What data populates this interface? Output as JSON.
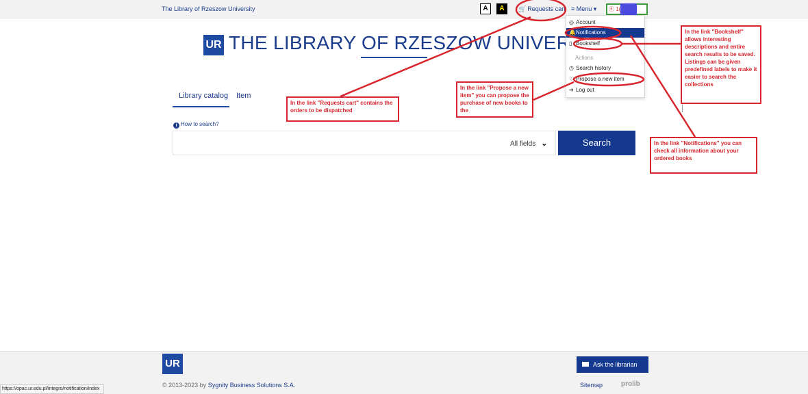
{
  "header": {
    "site_link": "The Library of Rzeszow University",
    "contrast_normal": "A",
    "contrast_high": "A",
    "cart_label": "Requests cart",
    "menu_label": "≡ Menu ▾",
    "user_label": "Ⓔ 1("
  },
  "logo": {
    "mark": "UR",
    "title": "THE LIBRARY OF RZESZOW UNIVERS"
  },
  "tabs": [
    {
      "label": "Library catalog",
      "active": true
    },
    {
      "label": "Item",
      "active": false
    }
  ],
  "search": {
    "help_link": "How to search?",
    "placeholder": "",
    "field_selected": "All fields",
    "button_label": "Search"
  },
  "menu": {
    "items": [
      {
        "label": "Account",
        "icon": "user-circle-icon"
      },
      {
        "label": "Notifications",
        "icon": "bell-icon",
        "active": true
      },
      {
        "label": "Bookshelf",
        "icon": "bookmark-icon"
      }
    ],
    "actions_heading": "Actions",
    "actions": [
      {
        "label": "Search history",
        "icon": "clock-icon"
      },
      {
        "label": "Propose a new item",
        "icon": "lightbulb-icon"
      },
      {
        "label": "Log out",
        "icon": "logout-icon"
      }
    ]
  },
  "annotations": {
    "cart": "In the link \"Requests cart\" contains the orders to be dispatched",
    "propose": "In the link \"Propose a new item\" you can propose the purchase of new books to the",
    "bookshelf": "In the link \"Bookshelf\" allows interesting descriptions and entire search results to be saved. Listings can be given predefined labels to make it easier to search the collections",
    "notifications": "In the link \"Notifications\" you can check all information about your ordered books"
  },
  "footer": {
    "logo_mark": "UR",
    "ask_label": "Ask the librarian",
    "copyright_prefix": "© 2013-2023 by ",
    "copyright_company": "Sygnity Business Solutions S.A.",
    "sitemap": "Sitemap",
    "prolib": "prolib"
  },
  "status_url": "https://opac.ur.edu.pl/integro/notification/index",
  "colors": {
    "brand_blue": "#15398f",
    "annotation_red": "#d8262e",
    "user_highlight": "#3d9a3d"
  }
}
